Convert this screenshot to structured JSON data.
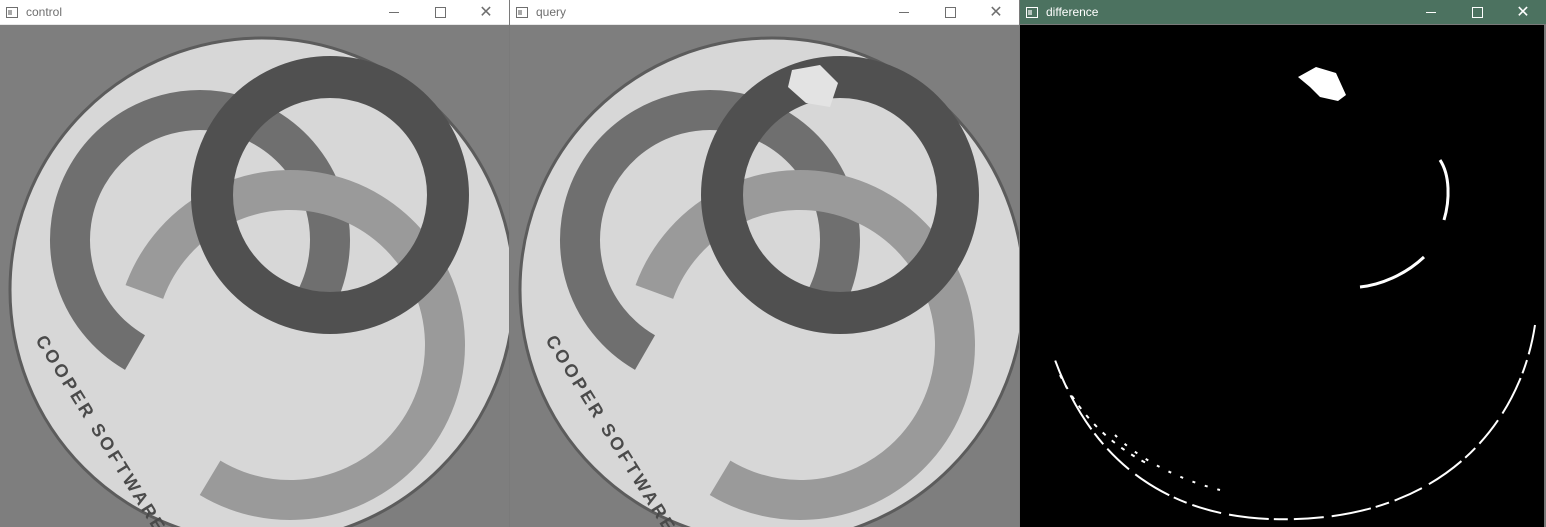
{
  "windows": [
    {
      "title": "control"
    },
    {
      "title": "query"
    },
    {
      "title": "difference"
    }
  ],
  "coaster": {
    "logo_text": "COOPER SOFTWARE"
  },
  "colors": {
    "active_titlebar": "#4c7260",
    "inactive_titlebar": "#ffffff",
    "difference_background": "#000000"
  },
  "icons": {
    "app": "window-icon",
    "minimize": "minimize-icon",
    "maximize": "maximize-icon",
    "close": "close-icon"
  }
}
